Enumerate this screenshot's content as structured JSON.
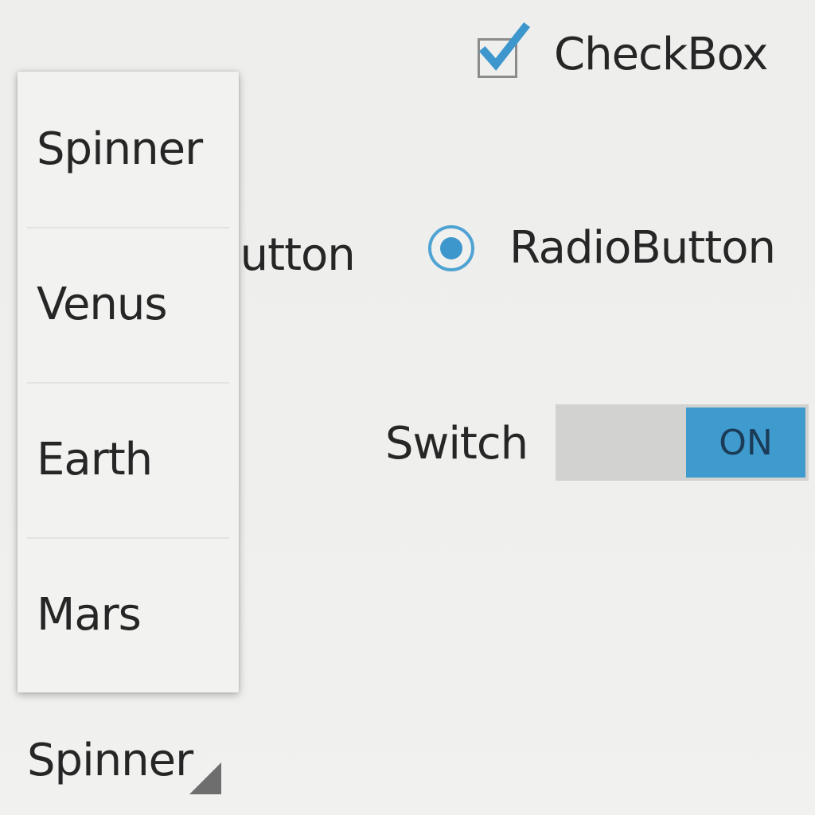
{
  "checkbox": {
    "label": "CheckBox",
    "checked": true,
    "icon": "check-icon"
  },
  "button": {
    "label": "Button"
  },
  "radio": {
    "label": "RadioButton",
    "selected": true
  },
  "switch": {
    "label": "Switch",
    "state_text": "ON",
    "on": true
  },
  "spinner": {
    "selected": "Spinner",
    "options": [
      "Spinner",
      "Venus",
      "Earth",
      "Mars"
    ],
    "corner_icon": "dropdown-triangle-icon"
  },
  "colors": {
    "accent": "#3f9bcd",
    "switch_track": "#d2d2d0",
    "background": "#eeeeec",
    "text": "#262626"
  }
}
